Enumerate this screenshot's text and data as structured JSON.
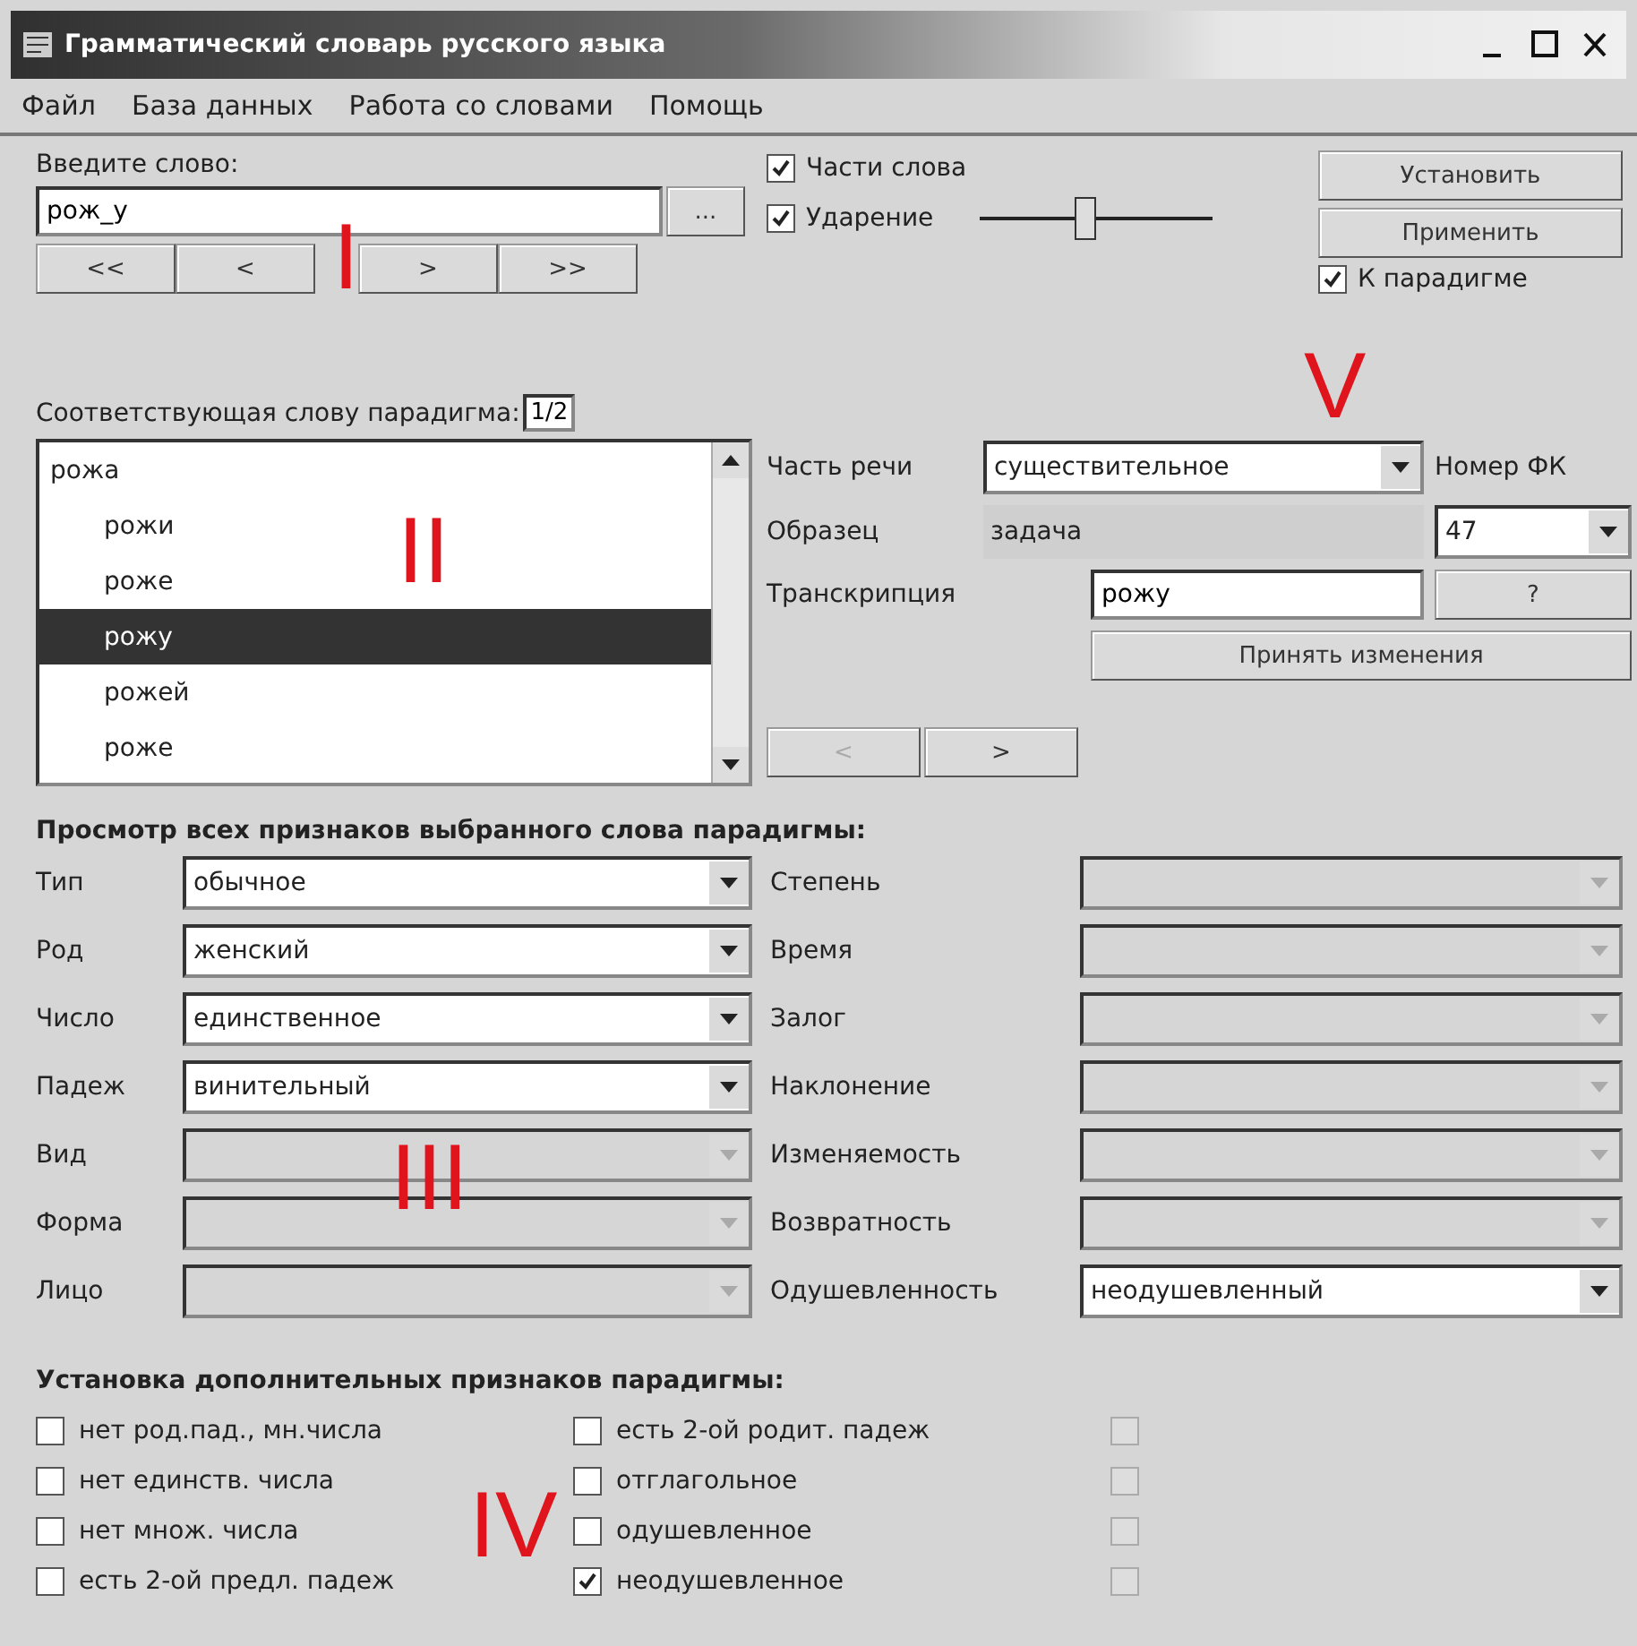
{
  "window": {
    "title": "Грамматический словарь русского языка"
  },
  "menu": [
    "Файл",
    "База данных",
    "Работа со словами",
    "Помощь"
  ],
  "word_entry": {
    "label": "Введите слово:",
    "value": "рож_у",
    "browse_button": "...",
    "nav_buttons": [
      "<<",
      "<",
      ">",
      ">>"
    ]
  },
  "display_options": [
    {
      "label": "Части слова",
      "checked": true
    },
    {
      "label": "Ударение",
      "checked": true
    }
  ],
  "stress_slider": {
    "level": 0.45
  },
  "actions": {
    "set_button": "Установить",
    "apply_button": "Применить",
    "to_paradigm": {
      "label": "К парадигме",
      "checked": true
    }
  },
  "paradigm": {
    "label": "Соответствующая слову парадигма:",
    "counter": "1/2",
    "items": [
      {
        "text": "рожа",
        "selected": false,
        "children": [
          {
            "text": "рожи",
            "selected": false
          },
          {
            "text": "роже",
            "selected": false
          },
          {
            "text": "рожу",
            "selected": true
          },
          {
            "text": "рожей",
            "selected": false
          },
          {
            "text": "роже",
            "selected": false
          }
        ]
      }
    ]
  },
  "word_info": {
    "part_of_speech": {
      "label": "Часть речи",
      "value": "существительное"
    },
    "fk_number": {
      "label": "Номер ФК",
      "value": "47"
    },
    "sample": {
      "label": "Образец",
      "value": "задача"
    },
    "transcription": {
      "label": "Транскрипция",
      "value": "рожу"
    },
    "help_button": "?",
    "accept_button": "Принять изменения",
    "nav_buttons": [
      {
        "text": "<",
        "disabled": true
      },
      {
        "text": ">",
        "disabled": false
      }
    ]
  },
  "features": {
    "title": "Просмотр всех признаков выбранного слова парадигмы:",
    "left": [
      {
        "label": "Тип",
        "value": "обычное",
        "disabled": false
      },
      {
        "label": "Род",
        "value": "женский",
        "disabled": false
      },
      {
        "label": "Число",
        "value": "единственное",
        "disabled": false
      },
      {
        "label": "Падеж",
        "value": "винительный",
        "disabled": false
      },
      {
        "label": "Вид",
        "disabled": true
      },
      {
        "label": "Форма",
        "disabled": true
      },
      {
        "label": "Лицо",
        "disabled": true
      }
    ],
    "right": [
      {
        "label": "Степень",
        "disabled": true
      },
      {
        "label": "Время",
        "disabled": true
      },
      {
        "label": "Залог",
        "disabled": true
      },
      {
        "label": "Наклонение",
        "disabled": true
      },
      {
        "label": "Изменяемость",
        "disabled": true
      },
      {
        "label": "Возвратность",
        "disabled": true
      },
      {
        "label": "Одушевленность",
        "value": "неодушевленный",
        "disabled": false
      }
    ]
  },
  "extra_features": {
    "title": "Установка дополнительных признаков парадигмы:",
    "columns": [
      [
        {
          "label": "нет род.пад., мн.числа",
          "checked": false,
          "disabled": false
        },
        {
          "label": "нет единств. числа",
          "checked": false,
          "disabled": false
        },
        {
          "label": "нет множ. числа",
          "checked": false,
          "disabled": false
        },
        {
          "label": "есть 2-ой предл. падеж",
          "checked": false,
          "disabled": false
        }
      ],
      [
        {
          "label": "есть 2-ой родит. падеж",
          "checked": false,
          "disabled": false
        },
        {
          "label": "отглагольное",
          "checked": false,
          "disabled": false
        },
        {
          "label": "одушевленное",
          "checked": false,
          "disabled": false
        },
        {
          "label": "неодушевленное",
          "checked": true,
          "disabled": false
        }
      ],
      [
        {
          "checked": false,
          "disabled": true
        },
        {
          "checked": false,
          "disabled": true
        },
        {
          "checked": false,
          "disabled": true
        },
        {
          "checked": false,
          "disabled": true
        }
      ]
    ]
  },
  "annotations": [
    "I",
    "II",
    "III",
    "IV",
    "V"
  ]
}
